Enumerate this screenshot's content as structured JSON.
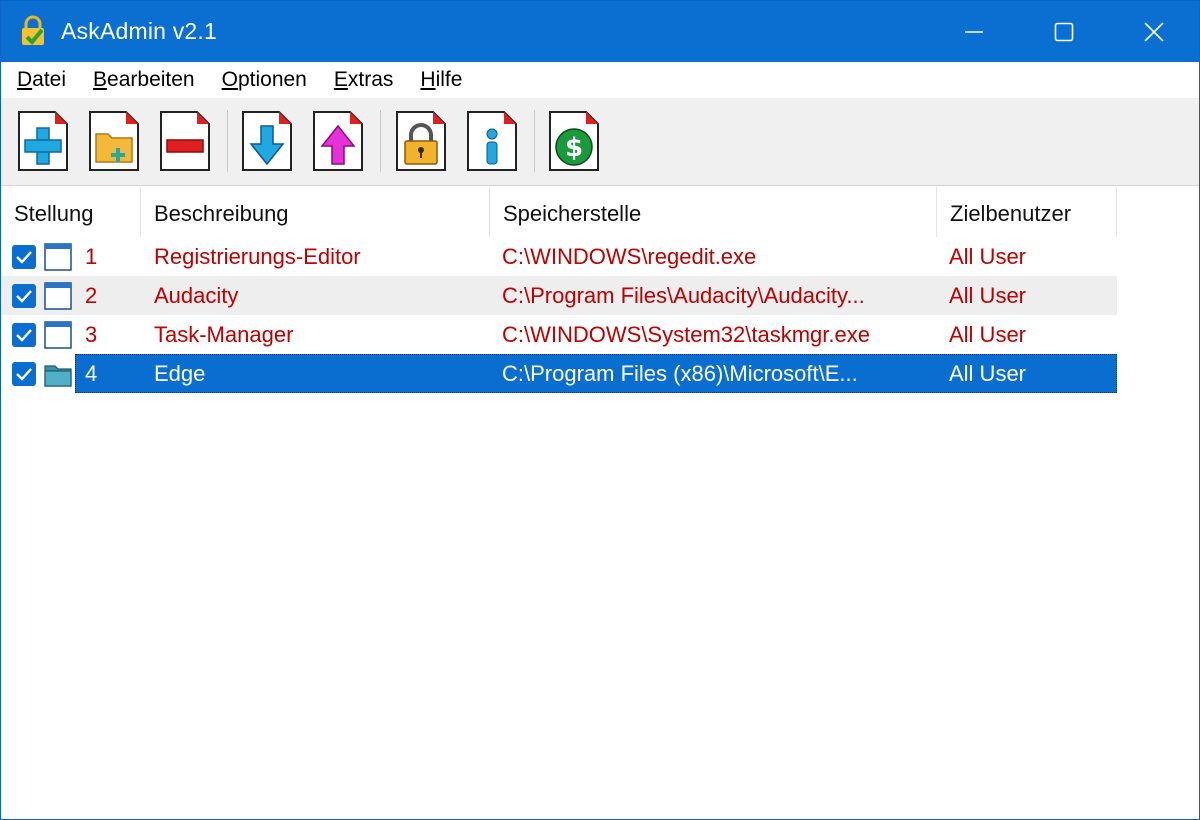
{
  "window": {
    "title": "AskAdmin v2.1",
    "accent_color": "#0b6fd1",
    "controls": [
      "minimize-icon",
      "maximize-icon",
      "close-icon"
    ]
  },
  "menu": [
    {
      "first": "D",
      "rest": "atei"
    },
    {
      "first": "B",
      "rest": "earbeiten"
    },
    {
      "first": "O",
      "rest": "ptionen"
    },
    {
      "first": "E",
      "rest": "xtras"
    },
    {
      "first": "H",
      "rest": "ilfe"
    }
  ],
  "toolbar": [
    "add-icon",
    "add-folder-icon",
    "remove-icon",
    "move-down-icon",
    "move-up-icon",
    "lock-icon",
    "info-icon",
    "donate-icon"
  ],
  "list": {
    "columns": [
      "Stellung",
      "Beschreibung",
      "Speicherstelle",
      "Zielbenutzer"
    ],
    "rows": [
      {
        "pos": "1",
        "desc": "Registrierungs-Editor",
        "path": "C:\\WINDOWS\\regedit.exe",
        "user": "All User",
        "icon": "app-window-icon",
        "checked": true
      },
      {
        "pos": "2",
        "desc": "Audacity",
        "path": "C:\\Program Files\\Audacity\\Audacity...",
        "user": "All User",
        "icon": "app-window-icon",
        "checked": true
      },
      {
        "pos": "3",
        "desc": "Task-Manager",
        "path": "C:\\WINDOWS\\System32\\taskmgr.exe",
        "user": "All User",
        "icon": "app-window-icon",
        "checked": true
      },
      {
        "pos": "4",
        "desc": "Edge",
        "path": "C:\\Program Files (x86)\\Microsoft\\E...",
        "user": "All User",
        "icon": "folder-icon",
        "checked": true
      }
    ],
    "text_color": "#c00000",
    "selection_color": "#0a6ed1"
  }
}
